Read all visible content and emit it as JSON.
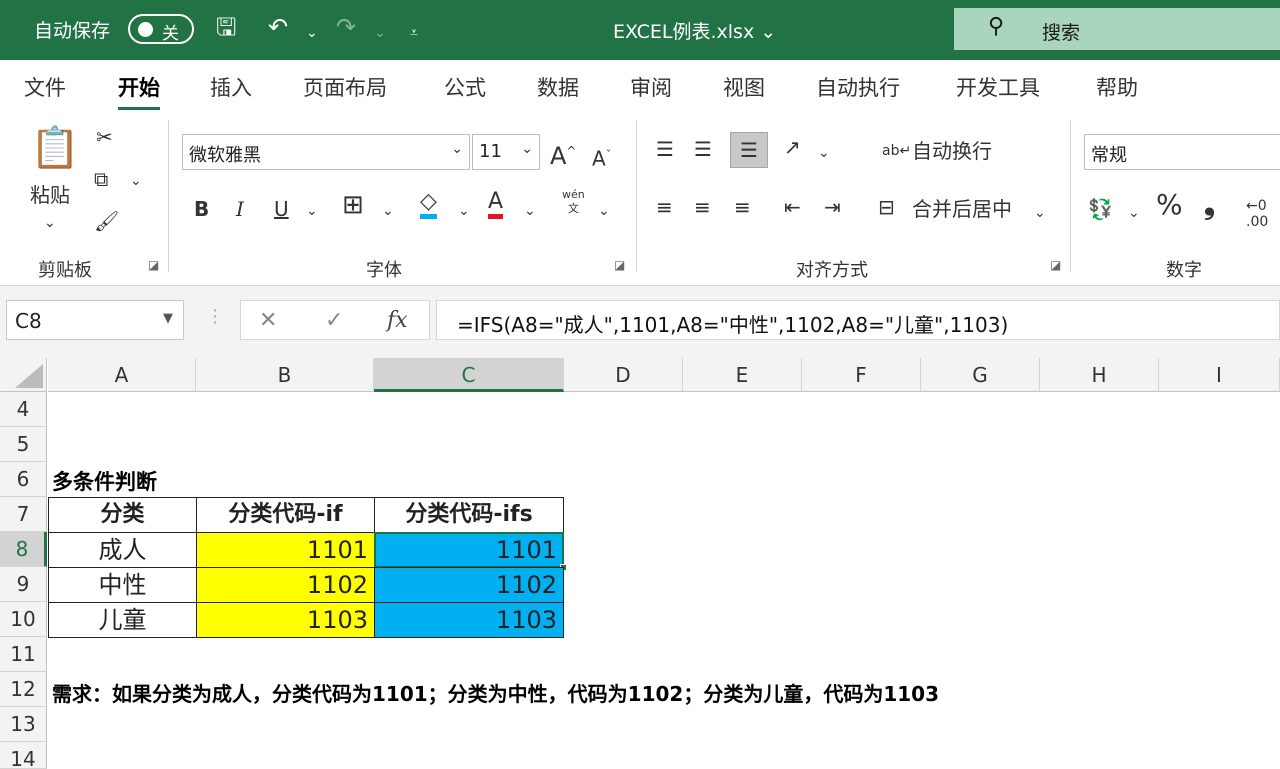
{
  "titlebar": {
    "autosave_label": "自动保存",
    "autosave_state": "关",
    "filename": "EXCEL例表.xlsx",
    "search_label": "搜索",
    "accent": "#217346"
  },
  "tabs": [
    "文件",
    "开始",
    "插入",
    "页面布局",
    "公式",
    "数据",
    "审阅",
    "视图",
    "自动执行",
    "开发工具",
    "帮助"
  ],
  "ribbon": {
    "clipboard": {
      "paste_label": "粘贴",
      "group_label": "剪贴板"
    },
    "font": {
      "name": "微软雅黑",
      "size": "11",
      "bold": "B",
      "italic": "I",
      "underline": "U",
      "font_color_glyph": "A",
      "phonetic_top": "wén",
      "phonetic_bottom": "文",
      "group_label": "字体"
    },
    "alignment": {
      "wrap_label": "自动换行",
      "merge_label": "合并后居中",
      "group_label": "对齐方式"
    },
    "number": {
      "format": "常规",
      "percent": "%",
      "comma": "❟",
      "decimal": ".00",
      "group_label": "数字"
    }
  },
  "formula_bar": {
    "name_box": "C8",
    "fx": "fx",
    "formula": "=IFS(A8=\"成人\",1101,A8=\"中性\",1102,A8=\"儿童\",1103)"
  },
  "grid": {
    "columns": [
      "A",
      "B",
      "C",
      "D",
      "E",
      "F",
      "G",
      "H",
      "I"
    ],
    "rows": [
      "4",
      "5",
      "6",
      "7",
      "8",
      "9",
      "10",
      "11",
      "12",
      "13",
      "14"
    ],
    "selected_column": "C",
    "selected_row": "8",
    "section_title": "多条件判断",
    "table": {
      "headers": [
        "分类",
        "分类代码-if",
        "分类代码-ifs"
      ],
      "rows": [
        [
          "成人",
          "1101",
          "1101"
        ],
        [
          "中性",
          "1102",
          "1102"
        ],
        [
          "儿童",
          "1103",
          "1103"
        ]
      ]
    },
    "requirement": "需求：如果分类为成人，分类代码为1101；分类为中性，代码为1102；分类为儿童，代码为1103",
    "fill_colors": {
      "if_column": "#ffff00",
      "ifs_column": "#00b0f0"
    }
  }
}
